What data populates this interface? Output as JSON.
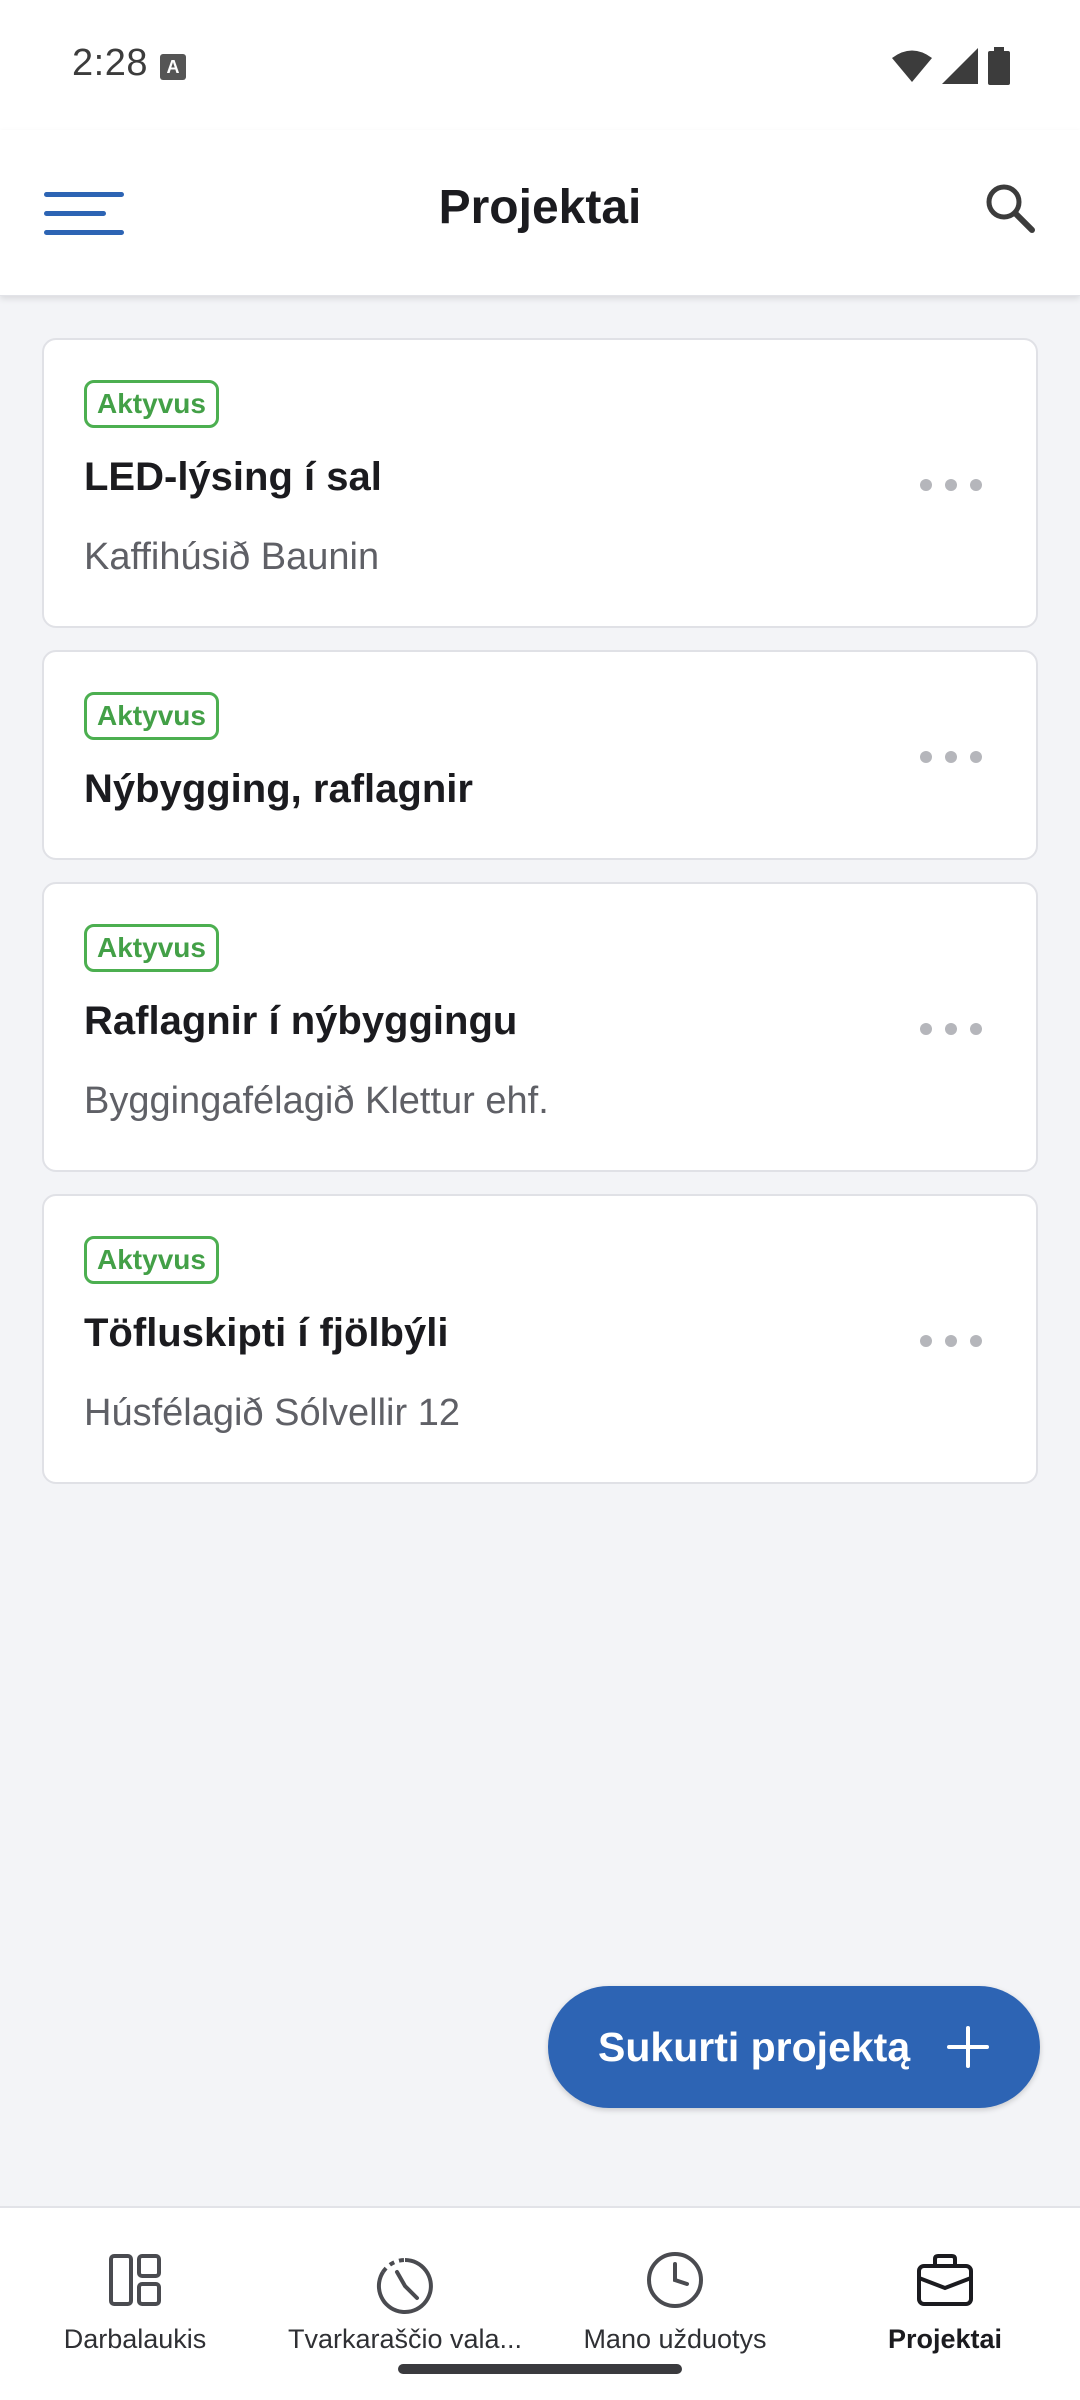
{
  "status_bar": {
    "time": "2:28",
    "notification_icon": "a-box-icon",
    "right_icons": [
      "wifi-icon",
      "signal-icon",
      "battery-icon"
    ]
  },
  "header": {
    "title": "Projektai",
    "left_icon": "menu-icon",
    "right_icon": "search-icon"
  },
  "projects": [
    {
      "status": "Aktyvus",
      "title": "LED-lýsing í sal",
      "client": "Kaffihúsið Baunin"
    },
    {
      "status": "Aktyvus",
      "title": "Nýbygging, raflagnir",
      "client": ""
    },
    {
      "status": "Aktyvus",
      "title": "Raflagnir í nýbyggingu",
      "client": "Byggingafélagið Klettur ehf."
    },
    {
      "status": "Aktyvus",
      "title": "Töfluskipti í fjölbýli",
      "client": "Húsfélagið Sólvellir 12"
    }
  ],
  "fab": {
    "label": "Sukurti projektą",
    "icon": "plus-icon"
  },
  "bottom_nav": [
    {
      "label": "Darbalaukis",
      "icon": "dashboard-icon",
      "active": false
    },
    {
      "label": "Tvarkaraščio vala...",
      "icon": "schedule-icon",
      "active": false
    },
    {
      "label": "Mano užduotys",
      "icon": "clock-icon",
      "active": false
    },
    {
      "label": "Projektai",
      "icon": "briefcase-icon",
      "active": true
    }
  ],
  "colors": {
    "accent": "#2d64b4",
    "status_active": "#43a047",
    "background": "#f3f4f7"
  }
}
